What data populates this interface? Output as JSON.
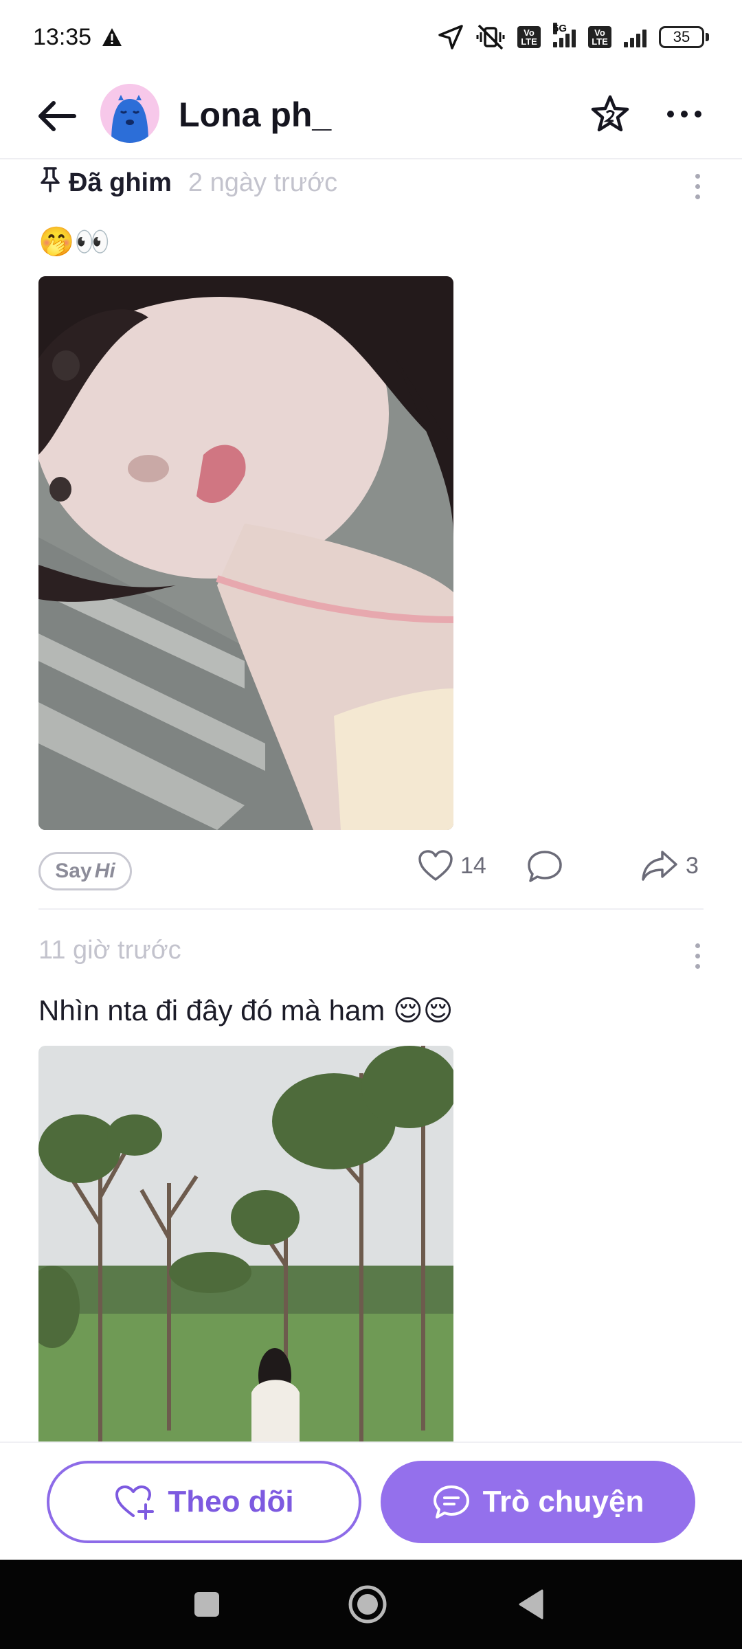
{
  "status_bar": {
    "time": "13:35",
    "network_1": "5G",
    "lte_label": "Vo LTE",
    "battery": "35"
  },
  "header": {
    "profile_name": "Lona ph_"
  },
  "posts": [
    {
      "pinned_label": "Đã ghim",
      "time": "2 ngày trước",
      "text": "🤭👀",
      "say_hi_say": "Say",
      "say_hi_hi": "Hi",
      "likes": "14",
      "shares": "3"
    },
    {
      "time": "11 giờ trước",
      "text": "Nhìn nta đi đây đó mà ham 😌😌"
    }
  ],
  "bottom": {
    "follow_label": "Theo dõi",
    "chat_label": "Trò chuyện"
  },
  "colors": {
    "accent": "#9470ec",
    "accent_text": "#7d5ae0"
  }
}
